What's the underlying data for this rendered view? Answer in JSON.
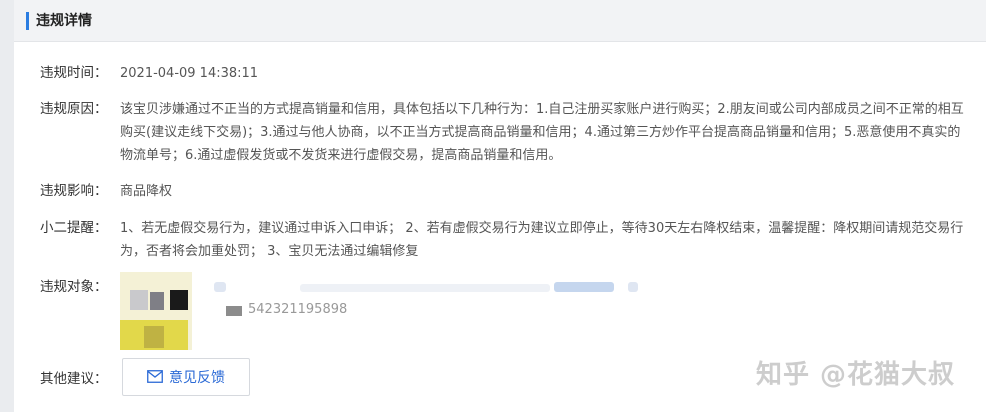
{
  "header": {
    "title": "违规详情"
  },
  "fields": {
    "time": {
      "label": "违规时间：",
      "value": "2021-04-09 14:38:11"
    },
    "reason": {
      "label": "违规原因：",
      "value": "该宝贝涉嫌通过不正当的方式提高销量和信用，具体包括以下几种行为：1.自己注册买家账户进行购买；2.朋友间或公司内部成员之间不正常的相互购买(建议走线下交易)；3.通过与他人协商，以不正当方式提高商品销量和信用；4.通过第三方炒作平台提高商品销量和信用；5.恶意使用不真实的物流单号；6.通过虚假发货或不发货来进行虚假交易，提高商品销量和信用。"
    },
    "impact": {
      "label": "违规影响：",
      "value": "商品降权"
    },
    "reminder": {
      "label": "小二提醒：",
      "value": "1、若无虚假交易行为，建议通过申诉入口申诉； 2、若有虚假交易行为建议立即停止，等待30天左右降权结束，温馨提醒：降权期间请规范交易行为，否者将会加重处罚； 3、宝贝无法通过编辑修复"
    },
    "object": {
      "label": "违规对象：",
      "id_text": "542321195898"
    },
    "other": {
      "label": "其他建议："
    }
  },
  "feedback_button": {
    "label": "意见反馈",
    "icon": "mail-icon"
  },
  "watermark": {
    "text": "知乎 @花猫大叔"
  },
  "colors": {
    "accent": "#2b7de1",
    "link": "#2b6ad6"
  }
}
